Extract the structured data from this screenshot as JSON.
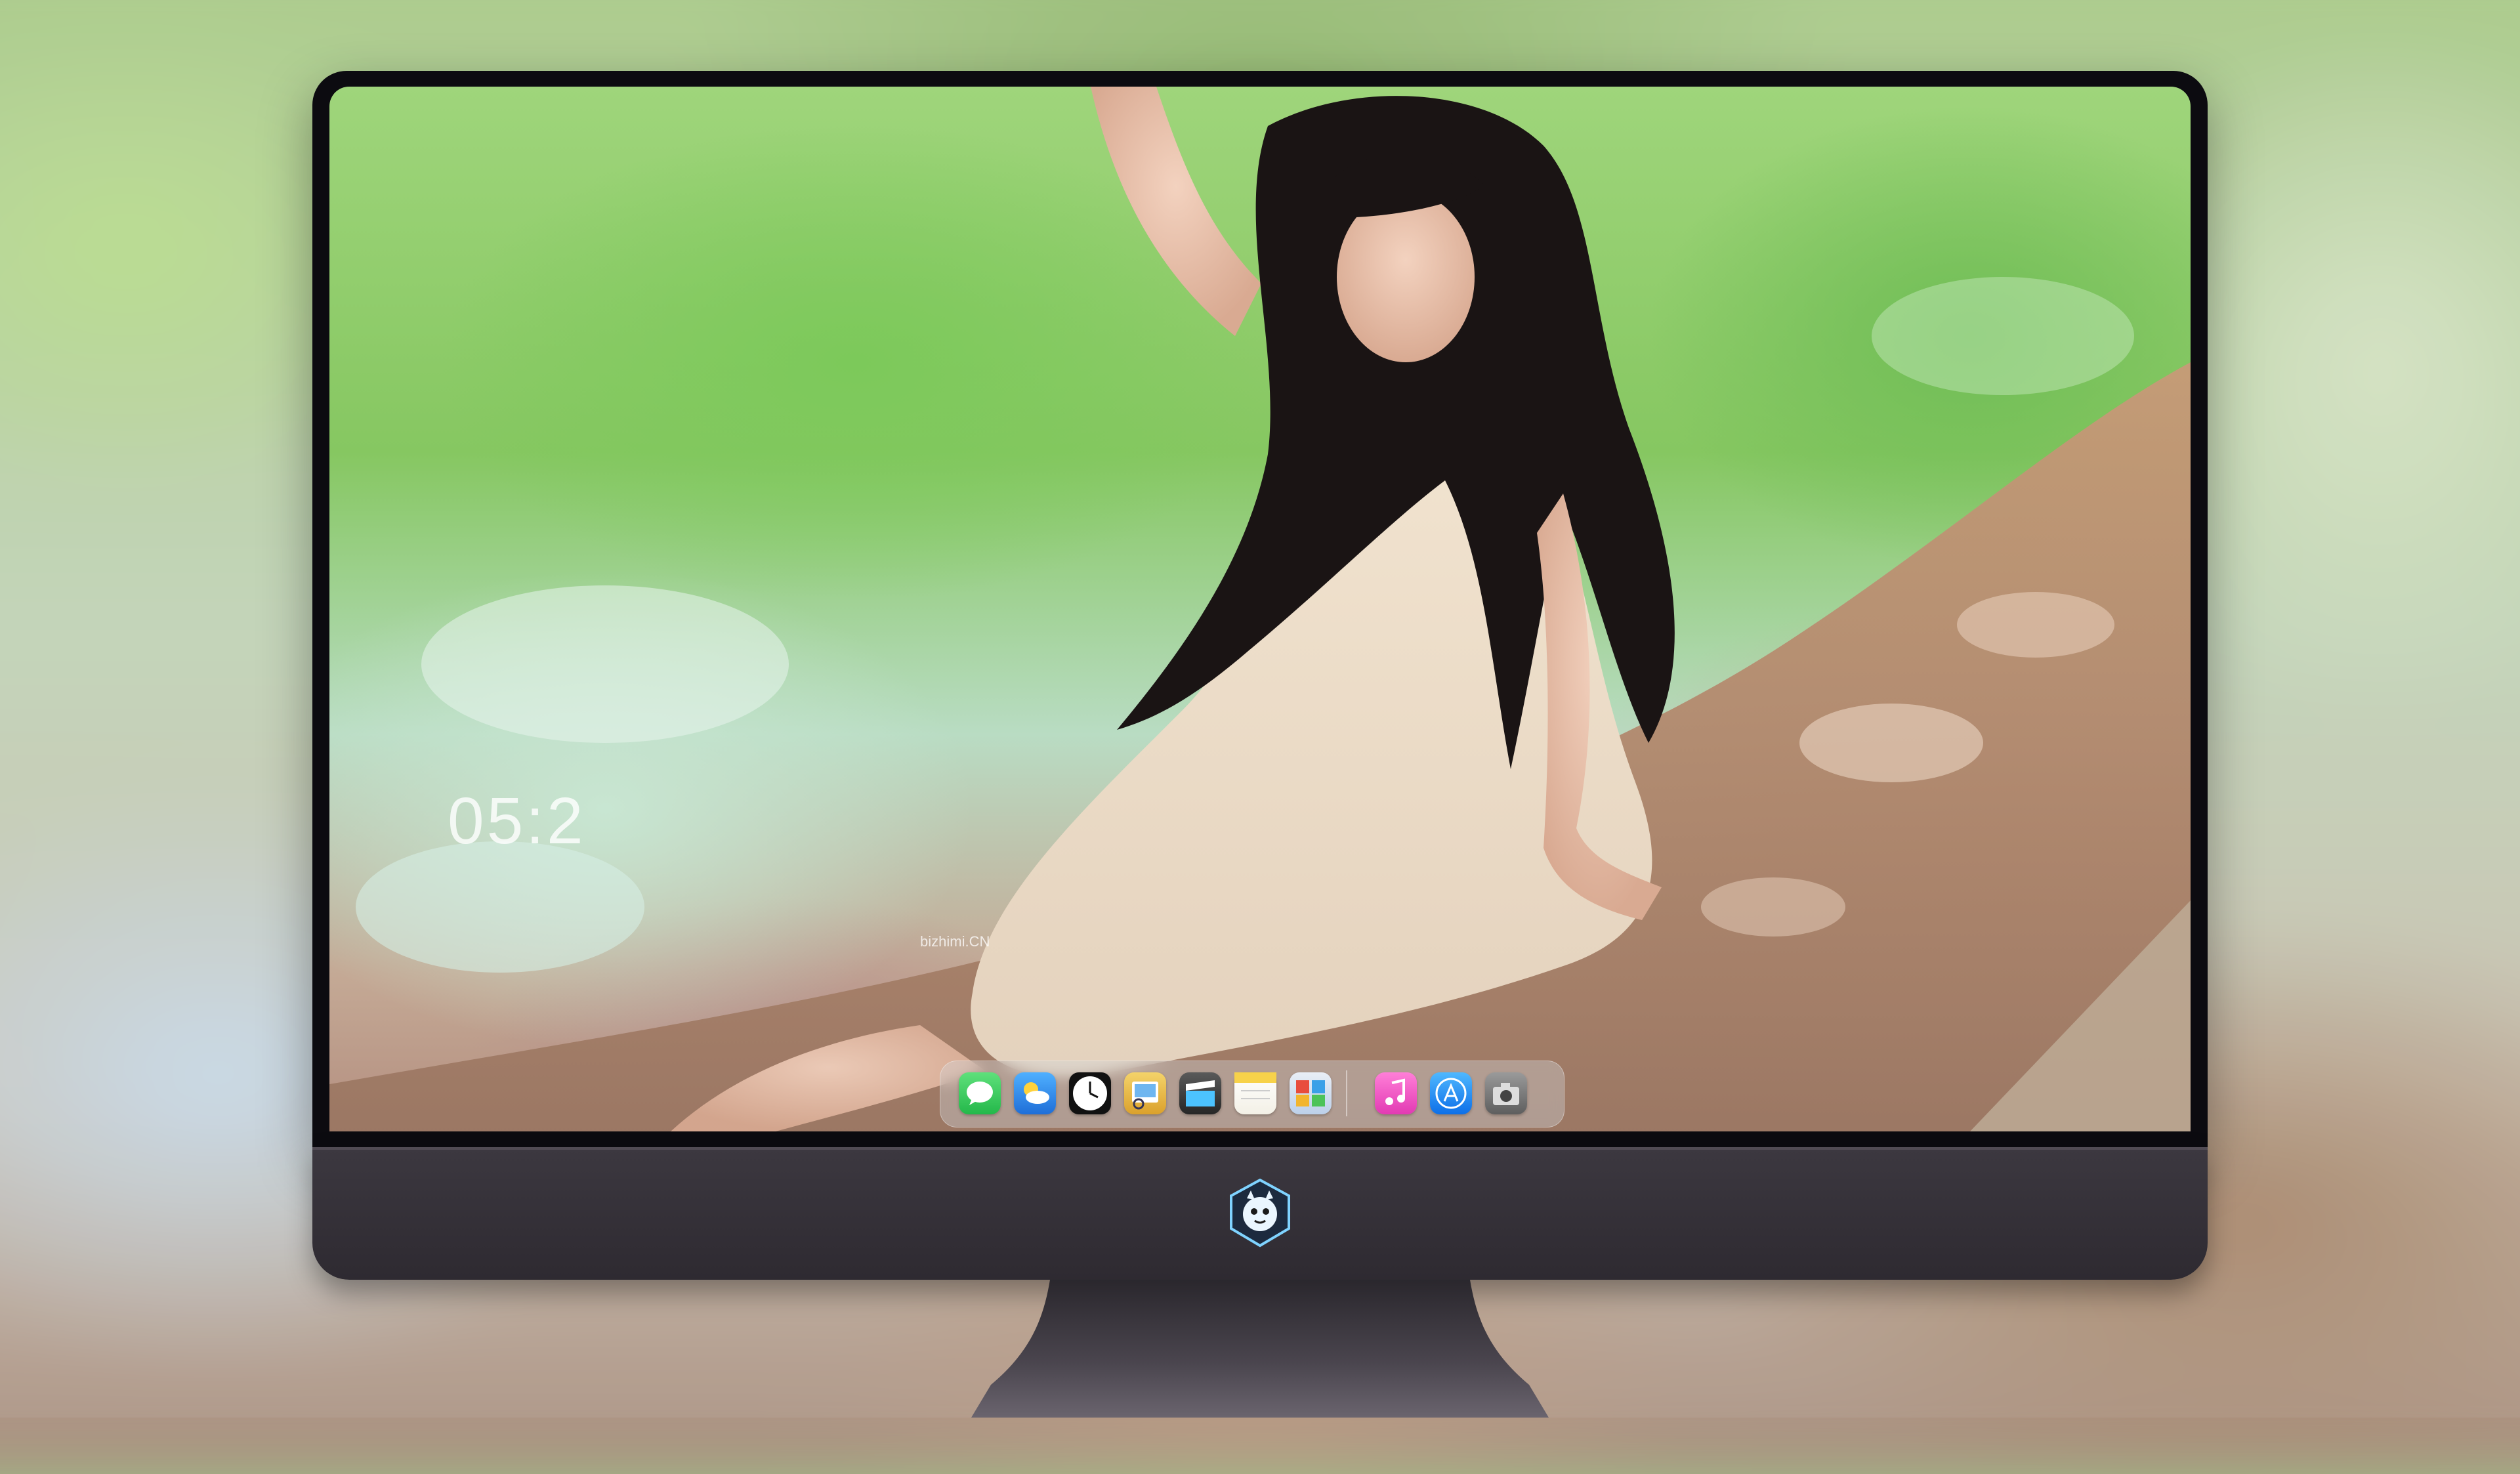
{
  "scene": {
    "description_role": "desktop-wallpaper-mockup",
    "monitor_color": "#2e2a31",
    "bezel_color": "#0c0b10"
  },
  "lock_screen": {
    "time": "05:2"
  },
  "wallpaper": {
    "watermark": "bizhimi.CN"
  },
  "dock": {
    "apps": [
      {
        "name": "messages-icon",
        "color": "#30d158"
      },
      {
        "name": "weather-icon",
        "color": "#2f8ff0"
      },
      {
        "name": "clock-icon",
        "color": "#111111"
      },
      {
        "name": "preview-icon",
        "color": "#e6b53c"
      },
      {
        "name": "final-cut-icon",
        "color": "#3a3a3a"
      },
      {
        "name": "notes-icon",
        "color": "#f7d24a"
      },
      {
        "name": "photo-browser-icon",
        "color": "#4a90d9"
      },
      {
        "name": "music-icon",
        "color": "#f95bd1"
      },
      {
        "name": "app-store-icon",
        "color": "#1a8cf5"
      },
      {
        "name": "camera-icon",
        "color": "#8a8a8a"
      }
    ]
  },
  "chin": {
    "logo_icon": "dragon-mascot-icon"
  }
}
